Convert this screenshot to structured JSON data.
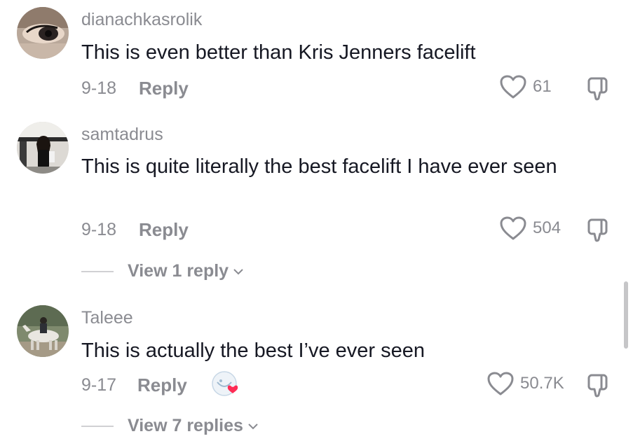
{
  "comments": [
    {
      "username": "dianachkasrolik",
      "text": "This is even better than Kris Jenners facelift",
      "date": "9-18",
      "reply_label": "Reply",
      "likes": "61",
      "avatar_icon": "avatar-eye-makeup"
    },
    {
      "username": "samtadrus",
      "text": "This is quite literally the best facelift I have ever seen",
      "date": "9-18",
      "reply_label": "Reply",
      "likes": "504",
      "avatar_icon": "avatar-person-black-outfit",
      "view_replies": "View 1 reply"
    },
    {
      "username": "Taleee",
      "text": "This is actually the best I’ve ever seen",
      "date": "9-17",
      "reply_label": "Reply",
      "likes": "50.7K",
      "avatar_icon": "avatar-horse-rider",
      "creator_liked_icon": "creator-liked-sticker",
      "view_replies": "View 7 replies"
    }
  ],
  "colors": {
    "text_primary": "#161823",
    "text_secondary": "#8a8b91",
    "heart_accent": "#fe2c55"
  }
}
